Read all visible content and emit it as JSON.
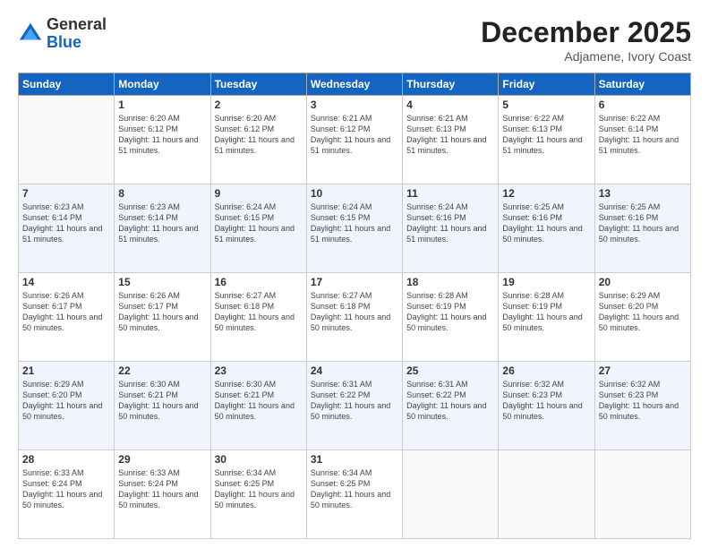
{
  "header": {
    "logo_line1": "General",
    "logo_line2": "Blue",
    "month": "December 2025",
    "location": "Adjamene, Ivory Coast"
  },
  "weekdays": [
    "Sunday",
    "Monday",
    "Tuesday",
    "Wednesday",
    "Thursday",
    "Friday",
    "Saturday"
  ],
  "weeks": [
    [
      {
        "day": "",
        "sunrise": "",
        "sunset": "",
        "daylight": ""
      },
      {
        "day": "1",
        "sunrise": "Sunrise: 6:20 AM",
        "sunset": "Sunset: 6:12 PM",
        "daylight": "Daylight: 11 hours and 51 minutes."
      },
      {
        "day": "2",
        "sunrise": "Sunrise: 6:20 AM",
        "sunset": "Sunset: 6:12 PM",
        "daylight": "Daylight: 11 hours and 51 minutes."
      },
      {
        "day": "3",
        "sunrise": "Sunrise: 6:21 AM",
        "sunset": "Sunset: 6:12 PM",
        "daylight": "Daylight: 11 hours and 51 minutes."
      },
      {
        "day": "4",
        "sunrise": "Sunrise: 6:21 AM",
        "sunset": "Sunset: 6:13 PM",
        "daylight": "Daylight: 11 hours and 51 minutes."
      },
      {
        "day": "5",
        "sunrise": "Sunrise: 6:22 AM",
        "sunset": "Sunset: 6:13 PM",
        "daylight": "Daylight: 11 hours and 51 minutes."
      },
      {
        "day": "6",
        "sunrise": "Sunrise: 6:22 AM",
        "sunset": "Sunset: 6:14 PM",
        "daylight": "Daylight: 11 hours and 51 minutes."
      }
    ],
    [
      {
        "day": "7",
        "sunrise": "Sunrise: 6:23 AM",
        "sunset": "Sunset: 6:14 PM",
        "daylight": "Daylight: 11 hours and 51 minutes."
      },
      {
        "day": "8",
        "sunrise": "Sunrise: 6:23 AM",
        "sunset": "Sunset: 6:14 PM",
        "daylight": "Daylight: 11 hours and 51 minutes."
      },
      {
        "day": "9",
        "sunrise": "Sunrise: 6:24 AM",
        "sunset": "Sunset: 6:15 PM",
        "daylight": "Daylight: 11 hours and 51 minutes."
      },
      {
        "day": "10",
        "sunrise": "Sunrise: 6:24 AM",
        "sunset": "Sunset: 6:15 PM",
        "daylight": "Daylight: 11 hours and 51 minutes."
      },
      {
        "day": "11",
        "sunrise": "Sunrise: 6:24 AM",
        "sunset": "Sunset: 6:16 PM",
        "daylight": "Daylight: 11 hours and 51 minutes."
      },
      {
        "day": "12",
        "sunrise": "Sunrise: 6:25 AM",
        "sunset": "Sunset: 6:16 PM",
        "daylight": "Daylight: 11 hours and 50 minutes."
      },
      {
        "day": "13",
        "sunrise": "Sunrise: 6:25 AM",
        "sunset": "Sunset: 6:16 PM",
        "daylight": "Daylight: 11 hours and 50 minutes."
      }
    ],
    [
      {
        "day": "14",
        "sunrise": "Sunrise: 6:26 AM",
        "sunset": "Sunset: 6:17 PM",
        "daylight": "Daylight: 11 hours and 50 minutes."
      },
      {
        "day": "15",
        "sunrise": "Sunrise: 6:26 AM",
        "sunset": "Sunset: 6:17 PM",
        "daylight": "Daylight: 11 hours and 50 minutes."
      },
      {
        "day": "16",
        "sunrise": "Sunrise: 6:27 AM",
        "sunset": "Sunset: 6:18 PM",
        "daylight": "Daylight: 11 hours and 50 minutes."
      },
      {
        "day": "17",
        "sunrise": "Sunrise: 6:27 AM",
        "sunset": "Sunset: 6:18 PM",
        "daylight": "Daylight: 11 hours and 50 minutes."
      },
      {
        "day": "18",
        "sunrise": "Sunrise: 6:28 AM",
        "sunset": "Sunset: 6:19 PM",
        "daylight": "Daylight: 11 hours and 50 minutes."
      },
      {
        "day": "19",
        "sunrise": "Sunrise: 6:28 AM",
        "sunset": "Sunset: 6:19 PM",
        "daylight": "Daylight: 11 hours and 50 minutes."
      },
      {
        "day": "20",
        "sunrise": "Sunrise: 6:29 AM",
        "sunset": "Sunset: 6:20 PM",
        "daylight": "Daylight: 11 hours and 50 minutes."
      }
    ],
    [
      {
        "day": "21",
        "sunrise": "Sunrise: 6:29 AM",
        "sunset": "Sunset: 6:20 PM",
        "daylight": "Daylight: 11 hours and 50 minutes."
      },
      {
        "day": "22",
        "sunrise": "Sunrise: 6:30 AM",
        "sunset": "Sunset: 6:21 PM",
        "daylight": "Daylight: 11 hours and 50 minutes."
      },
      {
        "day": "23",
        "sunrise": "Sunrise: 6:30 AM",
        "sunset": "Sunset: 6:21 PM",
        "daylight": "Daylight: 11 hours and 50 minutes."
      },
      {
        "day": "24",
        "sunrise": "Sunrise: 6:31 AM",
        "sunset": "Sunset: 6:22 PM",
        "daylight": "Daylight: 11 hours and 50 minutes."
      },
      {
        "day": "25",
        "sunrise": "Sunrise: 6:31 AM",
        "sunset": "Sunset: 6:22 PM",
        "daylight": "Daylight: 11 hours and 50 minutes."
      },
      {
        "day": "26",
        "sunrise": "Sunrise: 6:32 AM",
        "sunset": "Sunset: 6:23 PM",
        "daylight": "Daylight: 11 hours and 50 minutes."
      },
      {
        "day": "27",
        "sunrise": "Sunrise: 6:32 AM",
        "sunset": "Sunset: 6:23 PM",
        "daylight": "Daylight: 11 hours and 50 minutes."
      }
    ],
    [
      {
        "day": "28",
        "sunrise": "Sunrise: 6:33 AM",
        "sunset": "Sunset: 6:24 PM",
        "daylight": "Daylight: 11 hours and 50 minutes."
      },
      {
        "day": "29",
        "sunrise": "Sunrise: 6:33 AM",
        "sunset": "Sunset: 6:24 PM",
        "daylight": "Daylight: 11 hours and 50 minutes."
      },
      {
        "day": "30",
        "sunrise": "Sunrise: 6:34 AM",
        "sunset": "Sunset: 6:25 PM",
        "daylight": "Daylight: 11 hours and 50 minutes."
      },
      {
        "day": "31",
        "sunrise": "Sunrise: 6:34 AM",
        "sunset": "Sunset: 6:25 PM",
        "daylight": "Daylight: 11 hours and 50 minutes."
      },
      {
        "day": "",
        "sunrise": "",
        "sunset": "",
        "daylight": ""
      },
      {
        "day": "",
        "sunrise": "",
        "sunset": "",
        "daylight": ""
      },
      {
        "day": "",
        "sunrise": "",
        "sunset": "",
        "daylight": ""
      }
    ]
  ]
}
